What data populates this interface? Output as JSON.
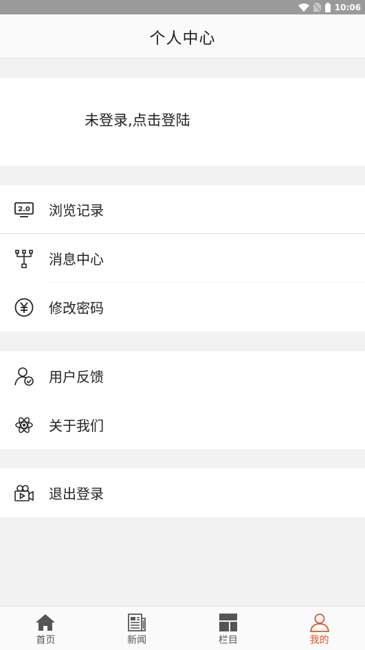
{
  "status_bar": {
    "time": "10:06",
    "icons": [
      "wifi-icon",
      "no-sim-icon",
      "battery-icon"
    ]
  },
  "header": {
    "title": "个人中心"
  },
  "login": {
    "prompt": "未登录,点击登陆"
  },
  "menu_groups": [
    {
      "items": [
        {
          "label": "浏览记录",
          "icon": "history-2-0-icon"
        },
        {
          "label": "消息中心",
          "icon": "message-network-icon"
        },
        {
          "label": "修改密码",
          "icon": "yen-circle-icon"
        }
      ]
    },
    {
      "items": [
        {
          "label": "用户反馈",
          "icon": "user-check-icon"
        },
        {
          "label": "关于我们",
          "icon": "atom-icon"
        }
      ]
    },
    {
      "items": [
        {
          "label": "退出登录",
          "icon": "video-camera-icon"
        }
      ]
    }
  ],
  "tab_bar": {
    "tabs": [
      {
        "label": "首页",
        "icon": "home-icon"
      },
      {
        "label": "新闻",
        "icon": "newspaper-icon"
      },
      {
        "label": "栏目",
        "icon": "columns-icon"
      },
      {
        "label": "我的",
        "icon": "person-icon",
        "active": true
      }
    ]
  },
  "colors": {
    "accent": "#e1541f",
    "status_bar": "#9a9a9a",
    "background": "#f2f2f2"
  }
}
